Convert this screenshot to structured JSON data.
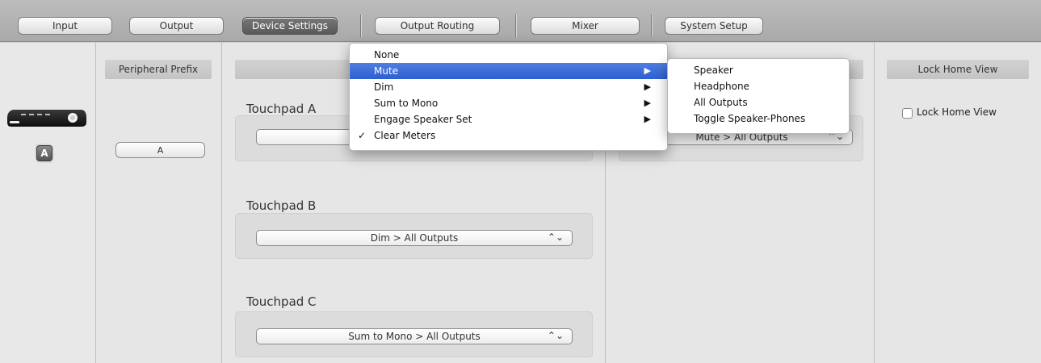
{
  "tabs": [
    {
      "label": "Input"
    },
    {
      "label": "Output"
    },
    {
      "label": "Device Settings",
      "active": true
    },
    {
      "label": "Output Routing"
    },
    {
      "label": "Mixer"
    },
    {
      "label": "System Setup"
    }
  ],
  "device": {
    "badge": "A"
  },
  "peripheral": {
    "header": "Peripheral Prefix",
    "button": "A"
  },
  "touchpads": {
    "a": {
      "label": "Touchpad A",
      "value": ""
    },
    "b": {
      "label": "Touchpad B",
      "value": "Dim > All Outputs"
    },
    "c": {
      "label": "Touchpad C",
      "value": "Sum to Mono > All Outputs"
    },
    "d": {
      "value": "Mute > All Outputs"
    }
  },
  "lock_home": {
    "header": "Lock Home View",
    "checkbox_label": "Lock Home View",
    "checked": false
  },
  "context_menu": {
    "items": [
      {
        "label": "None",
        "checked": false,
        "submenu": false
      },
      {
        "label": "Mute",
        "checked": false,
        "submenu": true,
        "highlighted": true
      },
      {
        "label": "Dim",
        "checked": false,
        "submenu": true
      },
      {
        "label": "Sum to Mono",
        "checked": false,
        "submenu": true
      },
      {
        "label": "Engage Speaker Set",
        "checked": false,
        "submenu": true
      },
      {
        "label": "Clear Meters",
        "checked": true,
        "submenu": false
      }
    ],
    "check_glyph": "✓",
    "submenu_glyph": "▶"
  },
  "submenu": {
    "items": [
      "Speaker",
      "Headphone",
      "All Outputs",
      "Toggle Speaker-Phones"
    ]
  },
  "popup_arrows": "⌃⌄",
  "colors": {
    "highlight": "#3466d6",
    "active_tab": "#666666"
  }
}
